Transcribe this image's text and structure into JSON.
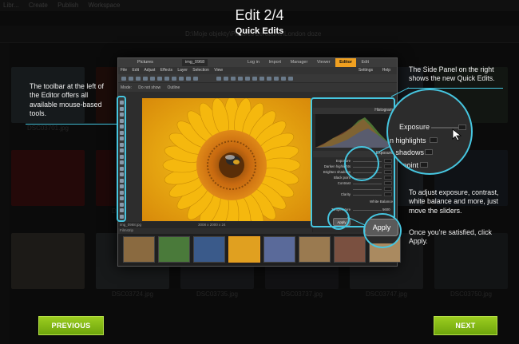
{
  "background": {
    "menu": [
      "Libr...",
      "Create",
      "Publish",
      "Workspace"
    ],
    "path": "D:\\Moje objekty\\Pictures\\zerobone\\London doze",
    "thumbs": [
      {
        "label": "DSC03701.jpg",
        "color": "#6b7d8a"
      },
      {
        "label": "",
        "color": "#8a3a30"
      },
      {
        "label": "",
        "color": "#7a6a55"
      },
      {
        "label": "",
        "color": "#556677"
      },
      {
        "label": "",
        "color": "#667788"
      },
      {
        "label": "",
        "color": "#5a6a5a"
      },
      {
        "label": "",
        "color": "#b03030"
      },
      {
        "label": "DSC03645.jpg",
        "color": "#9a3030"
      },
      {
        "label": "",
        "color": "#5a6070"
      },
      {
        "label": "",
        "color": "#707070"
      },
      {
        "label": "",
        "color": "#6a7a8a"
      },
      {
        "label": "",
        "color": "#4a5a6a"
      },
      {
        "label": "",
        "color": "#8a8070"
      },
      {
        "label": "DSC03724.jpg",
        "color": "#707a80"
      },
      {
        "label": "DSC03735.jpg",
        "color": "#606870"
      },
      {
        "label": "DSC03737.jpg",
        "color": "#5a5a60"
      },
      {
        "label": "DSC03747.jpg",
        "color": "#6a7078"
      },
      {
        "label": "DSC03750.jpg",
        "color": "#5a6268"
      }
    ]
  },
  "header": {
    "title": "Edit 2/4",
    "subtitle": "Quick Edits"
  },
  "app": {
    "title_tabs": [
      "Pictures",
      "img_0968"
    ],
    "modes": [
      "Log in",
      "Import",
      "Manager",
      "Viewer",
      "Editor",
      "Edit"
    ],
    "active_mode": "Editor",
    "menu": [
      "File",
      "Edit",
      "Adjust",
      "Effects",
      "Layer",
      "Selection",
      "View"
    ],
    "right_menu": [
      "Settings",
      "Help"
    ],
    "toolbar2": [
      "Mode:",
      "Do not show",
      "Outline"
    ],
    "canvas_info": "3008 x 2000 x 24",
    "file_name": "img_0968.jpg",
    "filmstrip_label": "Filmstrip",
    "histogram_label": "Histogram",
    "exposure_label": "Exposure",
    "quick_edits": [
      "Exposure",
      "Darken highlights",
      "Brighten shadows",
      "Black point",
      "Contrast",
      "",
      "Clarity"
    ],
    "white_balance_label": "White Balance",
    "temperature_label": "Temperature",
    "temperature_value": "5600",
    "apply_small": "Apply",
    "film_colors": [
      "#8a6a40",
      "#4a7a3a",
      "#3a5a8a",
      "#e0a020",
      "#5a6a9a",
      "#9a7a50",
      "#7a5040",
      "#aa8a60"
    ]
  },
  "callouts": {
    "left": "The toolbar at the left of the Editor offers all available mouse-based tools.",
    "top_right": "The Side Panel on the right shows the new Quick Edits.",
    "bottom_right_1": "To adjust exposure, contrast, white balance and more, just move the sliders.",
    "bottom_right_2": "Once you're satisfied, click Apply."
  },
  "zoom": {
    "items": [
      "Exposure",
      "n highlights",
      "n shadows",
      "ack point",
      "rast"
    ]
  },
  "apply_big": "Apply",
  "nav": {
    "previous": "PREVIOUS",
    "next": "NEXT"
  },
  "colors": {
    "accent": "#46c6e0",
    "button_green": "#86bb16",
    "editor_tab": "#f0a020"
  }
}
